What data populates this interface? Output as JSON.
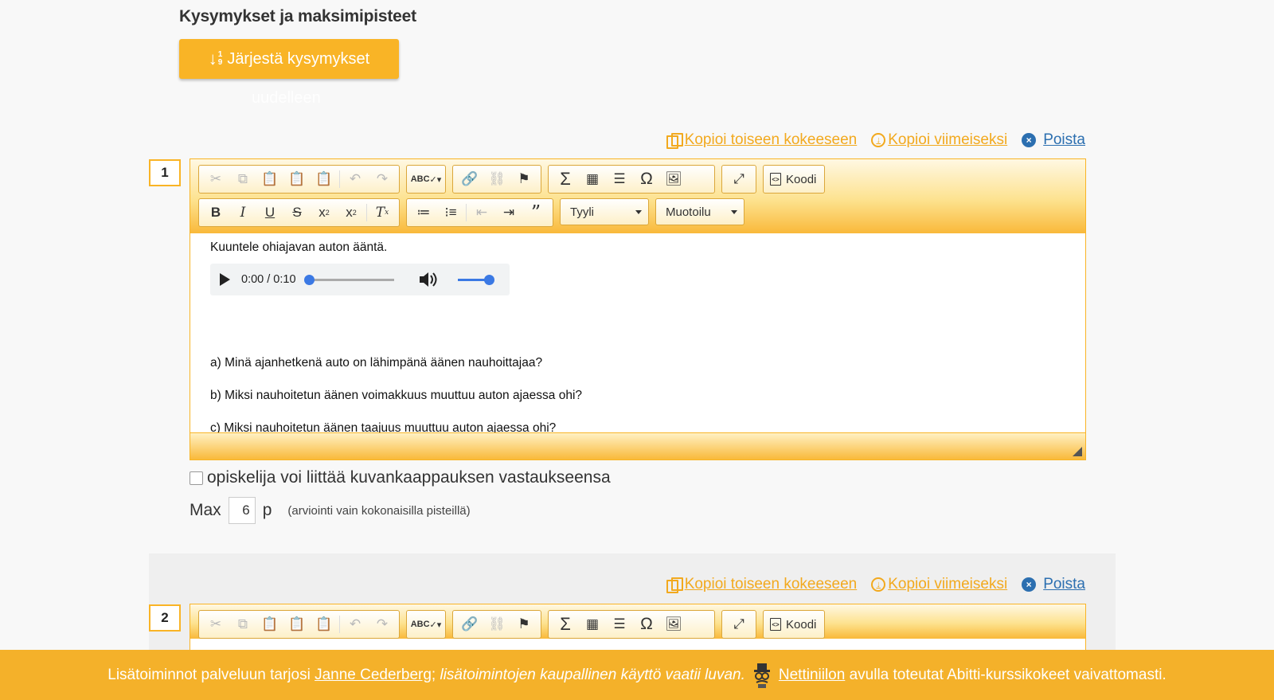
{
  "header": {
    "section_title": "Kysymykset ja maksimipisteet",
    "sort_button": "Järjestä kysymykset",
    "sort_icon_digits": [
      "1",
      "9"
    ],
    "ghost_text": "uudelleen"
  },
  "actions": {
    "copy_to_other": "Kopioi toiseen kokeeseen",
    "copy_last": "Kopioi viimeiseksi",
    "delete": "Poista"
  },
  "toolbar": {
    "style_combo": "Tyyli",
    "format_combo": "Muotoilu",
    "source_button": "Koodi",
    "spell_label": "ABC"
  },
  "questions": [
    {
      "number": "1",
      "audio_time": "0:00 / 0:10",
      "content": {
        "intro": "Kuuntele ohiajavan auton ääntä.",
        "a": "a) Minä ajanhetkenä auto on lähimpänä äänen nauhoittajaa?",
        "b": "b) Miksi nauhoitetun äänen voimakkuus muuttuu auton ajaessa ohi?",
        "c": "c) Miksi nauhoitetun äänen taajuus muuttuu auton ajaessa ohi?"
      },
      "screenshot_label": "opiskelija voi liittää kuvankaappauksen vastaukseensa",
      "max_label": "Max",
      "max_value": "6",
      "unit": "p",
      "note": "(arviointi vain kokonaisilla pisteillä)"
    },
    {
      "number": "2"
    }
  ],
  "footer": {
    "prefix": "Lisätoiminnot palveluun tarjosi",
    "author_link": "Janne Cederberg",
    "semicolon": ";",
    "italic_note": "lisätoimintojen kaupallinen käyttö vaatii luvan.",
    "nettiniilo_link": "Nettiniilon",
    "suffix": "avulla toteutat Abitti-kurssikokeet vaivattomasti."
  },
  "colors": {
    "accent": "#f9b426",
    "link_orange": "#f2a91e",
    "link_blue": "#2c6fb0",
    "footer_bg": "#f4b12a"
  }
}
